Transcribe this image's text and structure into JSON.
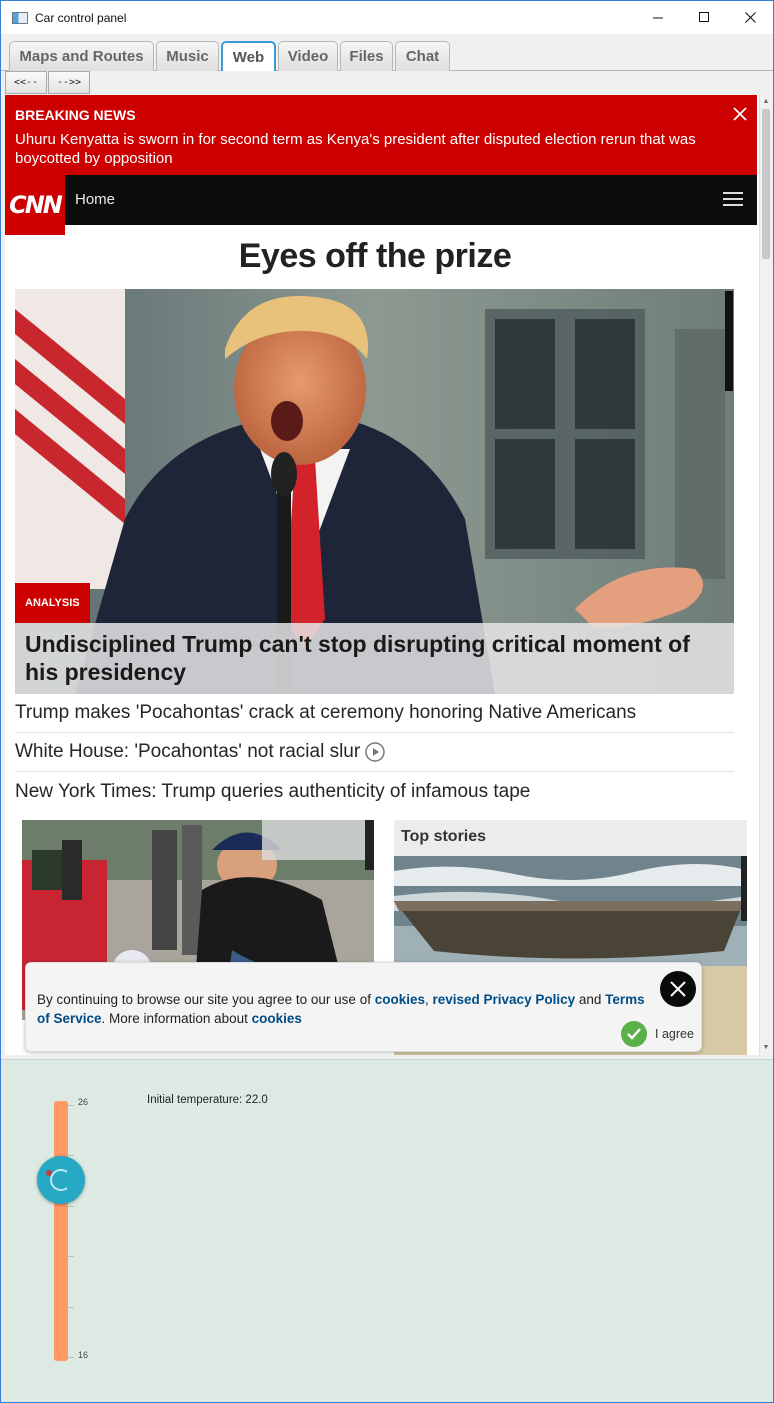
{
  "window": {
    "title": "Car control panel",
    "minimize_icon": "minimize-icon",
    "maximize_icon": "maximize-icon",
    "close_icon": "close-icon"
  },
  "tabs": [
    {
      "label": "Maps and Routes",
      "active": false
    },
    {
      "label": "Music",
      "active": false
    },
    {
      "label": "Web",
      "active": true
    },
    {
      "label": "Video",
      "active": false
    },
    {
      "label": "Files",
      "active": false
    },
    {
      "label": "Chat",
      "active": false
    }
  ],
  "nav": {
    "back_label": "<<--",
    "forward_label": "-->>"
  },
  "page": {
    "breaking": {
      "label": "BREAKING NEWS",
      "text": "Uhuru Kenyatta is sworn in for second term as Kenya's president after disputed election rerun that was boycotted by opposition"
    },
    "header": {
      "logo": "CNN",
      "home_label": "Home"
    },
    "headline": "Eyes off the prize",
    "hero": {
      "badge": "ANALYSIS",
      "caption": "Undisciplined Trump can't stop disrupting critical moment of his presidency"
    },
    "stories": [
      {
        "text": "Trump makes 'Pocahontas' crack at ceremony honoring Native Americans",
        "video": false
      },
      {
        "text": "White House: 'Pocahontas' not racial slur",
        "video": true
      },
      {
        "text": "New York Times: Trump queries authenticity of infamous tape",
        "video": false
      }
    ],
    "top_stories_title": "Top stories",
    "cookie": {
      "text_1": "By continuing to browse our site you agree to our use of ",
      "link_cookies": "cookies",
      "sep": ", ",
      "link_privacy": "revised Privacy Policy",
      "and": " and ",
      "link_terms": "Terms of Service",
      "text_2": ". More information about ",
      "link_cookies_2": "cookies",
      "agree_label": "I agree"
    }
  },
  "climate": {
    "readout": "Initial temperature: 22.0",
    "max_label": "26",
    "min_label": "16",
    "min": 16,
    "max": 26,
    "value": 22.0,
    "track_color": "#ff9966",
    "knob_color": "#27a8c4"
  },
  "colors": {
    "cnn_red": "#cc0000",
    "link_blue": "#004d86",
    "tab_active_border": "#3a9bd8"
  }
}
